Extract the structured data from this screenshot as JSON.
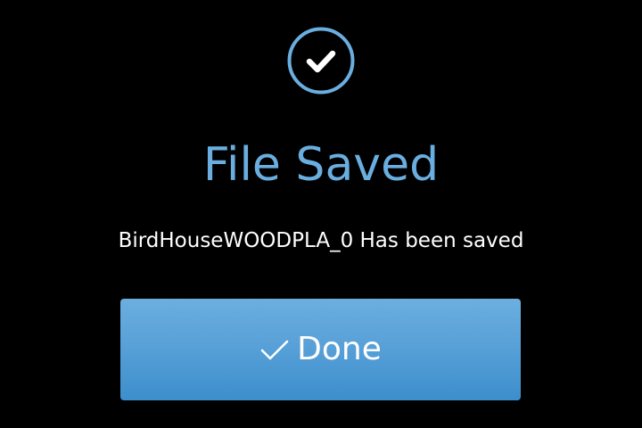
{
  "dialog": {
    "icon": "check-circle-icon",
    "title": "File Saved",
    "message": "BirdHouseWOODPLA_0 Has been saved",
    "done_button": {
      "icon": "check-icon",
      "label": "Done"
    }
  },
  "colors": {
    "background": "#000000",
    "title": "#6aaee0",
    "message": "#ffffff",
    "button_top": "#6cafdf",
    "button_bottom": "#3d8ecd",
    "button_text": "#ffffff"
  }
}
